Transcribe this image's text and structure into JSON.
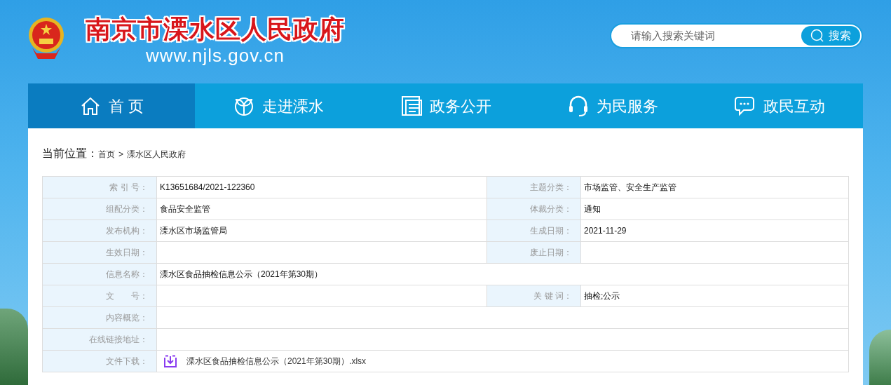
{
  "header": {
    "site_title": "南京市溧水区人民政府",
    "site_url": "www.njls.gov.cn",
    "search": {
      "placeholder": "请输入搜索关键词",
      "button": "搜索"
    }
  },
  "nav": [
    {
      "label": "首 页",
      "selected": true
    },
    {
      "label": "走进溧水",
      "selected": false
    },
    {
      "label": "政务公开",
      "selected": false
    },
    {
      "label": "为民服务",
      "selected": false
    },
    {
      "label": "政民互动",
      "selected": false
    }
  ],
  "breadcrumb": {
    "label": "当前位置：",
    "items": [
      "首页",
      "溧水区人民政府"
    ],
    "separator": ">"
  },
  "table": {
    "rows": [
      {
        "kind": "pair",
        "cells": [
          {
            "label": "索 引 号：",
            "value": "K13651684/2021-122360"
          },
          {
            "label": "主题分类：",
            "value": "市场监管、安全生产监管"
          }
        ]
      },
      {
        "kind": "pair",
        "cells": [
          {
            "label": "组配分类：",
            "value": "食品安全监管"
          },
          {
            "label": "体裁分类：",
            "value": "通知"
          }
        ]
      },
      {
        "kind": "pair",
        "cells": [
          {
            "label": "发布机构：",
            "value": "溧水区市场监管局"
          },
          {
            "label": "生成日期：",
            "value": "2021-11-29"
          }
        ]
      },
      {
        "kind": "pair",
        "cells": [
          {
            "label": "生效日期："
          },
          {
            "label": "废止日期："
          }
        ]
      },
      {
        "kind": "single",
        "cells": [
          {
            "label": "信息名称：",
            "value": "溧水区食品抽检信息公示（2021年第30期）"
          }
        ]
      },
      {
        "kind": "pair",
        "cells": [
          {
            "label": "文　　号："
          },
          {
            "label": "关 键 词：",
            "value": "抽检;公示"
          }
        ]
      },
      {
        "kind": "single",
        "cells": [
          {
            "label": "内容概览："
          }
        ]
      },
      {
        "kind": "single",
        "cells": [
          {
            "label": "在线链接地址："
          }
        ]
      },
      {
        "kind": "file",
        "cells": [
          {
            "label": "文件下载：",
            "value": "溧水区食品抽检信息公示（2021年第30期）.xlsx"
          }
        ]
      }
    ]
  }
}
